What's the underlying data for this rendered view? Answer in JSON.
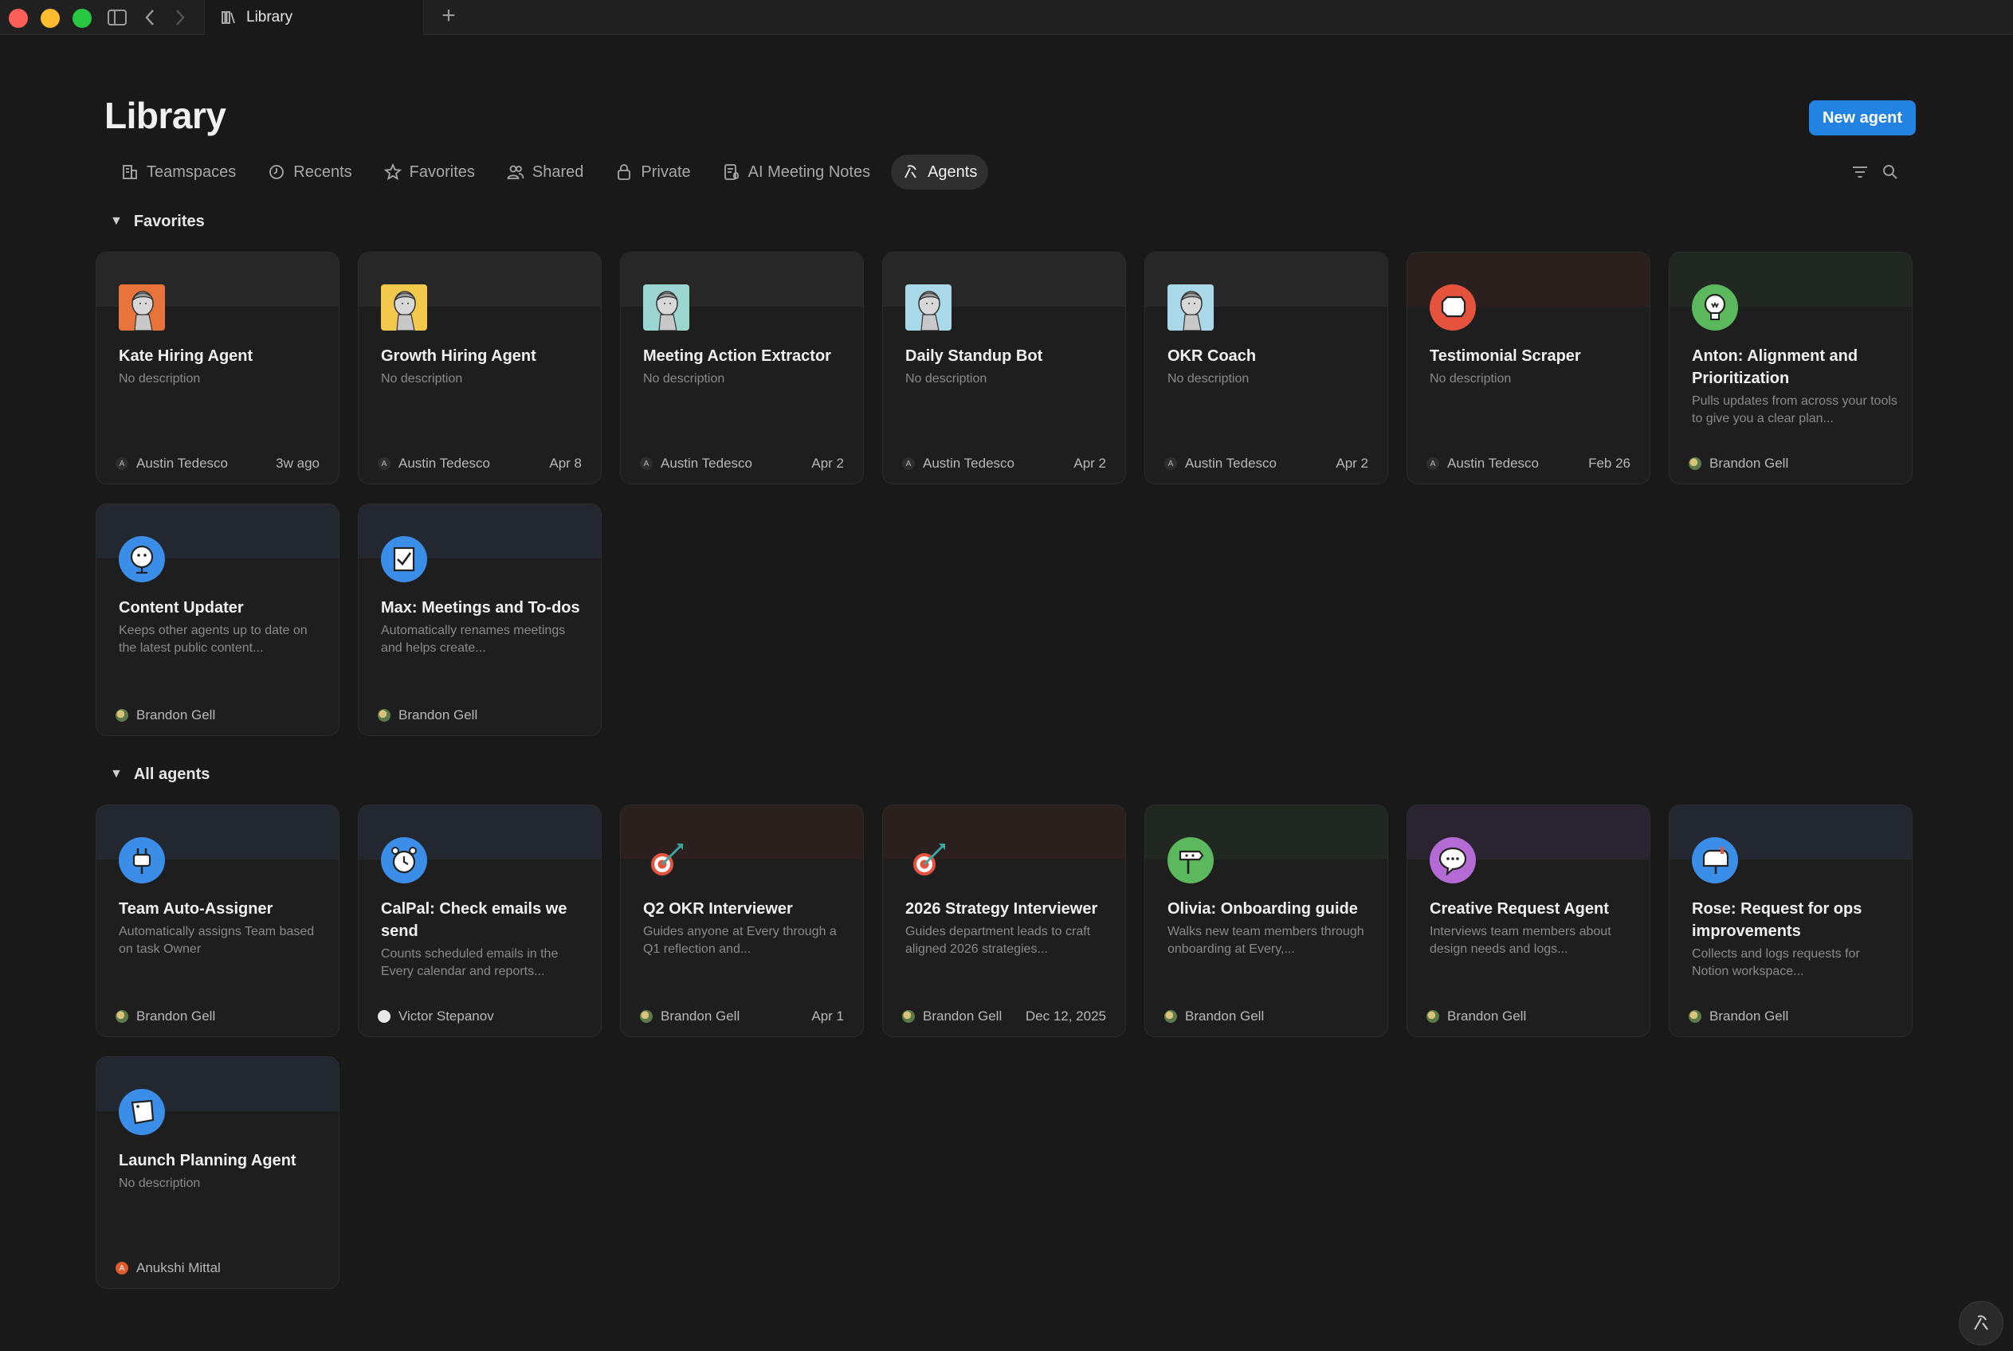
{
  "window": {
    "tab_title": "Library"
  },
  "header": {
    "title": "Library",
    "new_agent_label": "New agent"
  },
  "nav_tabs": [
    {
      "label": "Teamspaces",
      "icon": "building-icon"
    },
    {
      "label": "Recents",
      "icon": "clock-icon"
    },
    {
      "label": "Favorites",
      "icon": "star-icon"
    },
    {
      "label": "Shared",
      "icon": "people-icon"
    },
    {
      "label": "Private",
      "icon": "lock-icon"
    },
    {
      "label": "AI Meeting Notes",
      "icon": "meeting-notes-icon"
    },
    {
      "label": "Agents",
      "icon": "agent-icon",
      "active": true
    }
  ],
  "sections": {
    "favorites": {
      "label": "Favorites"
    },
    "all_agents": {
      "label": "All agents"
    }
  },
  "favorites": [
    {
      "title": "Kate Hiring Agent",
      "description": "No description",
      "owner": "Austin Tedesco",
      "date": "3w ago",
      "icon": "statue-icon",
      "accent": "#e8743b"
    },
    {
      "title": "Growth Hiring Agent",
      "description": "No description",
      "owner": "Austin Tedesco",
      "date": "Apr 8",
      "icon": "statue-icon",
      "accent": "#f2c94c"
    },
    {
      "title": "Meeting Action Extractor",
      "description": "No description",
      "owner": "Austin Tedesco",
      "date": "Apr 2",
      "icon": "statue-icon",
      "accent": "#9ad6cf"
    },
    {
      "title": "Daily Standup Bot",
      "description": "No description",
      "owner": "Austin Tedesco",
      "date": "Apr 2",
      "icon": "statue-icon",
      "accent": "#a9d8e8"
    },
    {
      "title": "OKR Coach",
      "description": "No description",
      "owner": "Austin Tedesco",
      "date": "Apr 2",
      "icon": "statue-icon",
      "accent": "#a9d8e8"
    },
    {
      "title": "Testimonial Scraper",
      "description": "No description",
      "owner": "Austin Tedesco",
      "date": "Feb 26",
      "icon": "speech-bubble-icon",
      "accent": "#e5533d"
    },
    {
      "title": "Anton: Alignment and Prioritization",
      "description": "Pulls updates from across your tools to give you a clear plan...",
      "owner": "Brandon Gell",
      "date": "",
      "icon": "lightbulb-icon",
      "accent": "#5cb85c"
    },
    {
      "title": "Content Updater",
      "description": "Keeps other agents up to date on the latest public content...",
      "owner": "Brandon Gell",
      "date": "",
      "icon": "globe-icon",
      "accent": "#3b8ee8"
    },
    {
      "title": "Max: Meetings and To-dos",
      "description": "Automatically renames meetings and helps create...",
      "owner": "Brandon Gell",
      "date": "",
      "icon": "checklist-icon",
      "accent": "#3b8ee8"
    }
  ],
  "all_agents": [
    {
      "title": "Team Auto-Assigner",
      "description": "Automatically assigns Team based on task Owner",
      "owner": "Brandon Gell",
      "date": "",
      "icon": "plug-icon",
      "accent": "#3b8ee8"
    },
    {
      "title": "CalPal: Check emails we send",
      "description": "Counts scheduled emails in the Every calendar and reports...",
      "owner": "Victor Stepanov",
      "date": "",
      "icon": "alarm-clock-icon",
      "accent": "#3b8ee8"
    },
    {
      "title": "Q2 OKR Interviewer",
      "description": "Guides anyone at Every through a Q1 reflection and...",
      "owner": "Brandon Gell",
      "date": "Apr 1",
      "icon": "target-icon",
      "accent": "#e5533d"
    },
    {
      "title": "2026 Strategy Interviewer",
      "description": "Guides department leads to craft aligned 2026 strategies...",
      "owner": "Brandon Gell",
      "date": "Dec 12, 2025",
      "icon": "target-icon",
      "accent": "#e5533d"
    },
    {
      "title": "Olivia: Onboarding guide",
      "description": "Walks new team members through onboarding at Every,...",
      "owner": "Brandon Gell",
      "date": "",
      "icon": "signpost-icon",
      "accent": "#5cb85c"
    },
    {
      "title": "Creative Request Agent",
      "description": "Interviews team members about design needs and logs...",
      "owner": "Brandon Gell",
      "date": "",
      "icon": "chat-bubble-icon",
      "accent": "#b56bd6"
    },
    {
      "title": "Rose: Request for ops improvements",
      "description": "Collects and logs requests for Notion workspace...",
      "owner": "Brandon Gell",
      "date": "",
      "icon": "mailbox-icon",
      "accent": "#3b8ee8"
    },
    {
      "title": "Launch Planning Agent",
      "description": "No description",
      "owner": "Anukshi Mittal",
      "date": "",
      "icon": "sticky-note-icon",
      "accent": "#3b8ee8"
    }
  ]
}
